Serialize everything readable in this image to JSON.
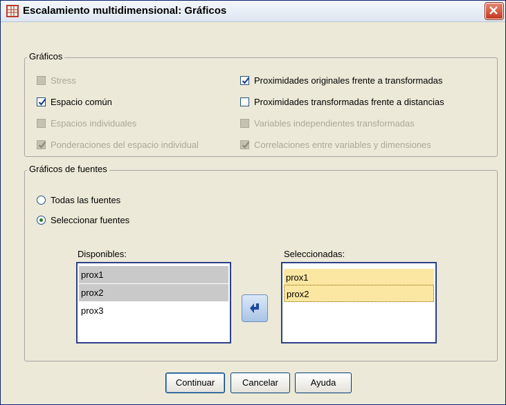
{
  "window": {
    "title": "Escalamiento multidimensional: Gráficos"
  },
  "graficos": {
    "label": "Gráficos",
    "options": [
      {
        "label": "Stress",
        "checked": false,
        "disabled": true
      },
      {
        "label": "Espacio común",
        "checked": true,
        "disabled": false
      },
      {
        "label": "Espacios individuales",
        "checked": false,
        "disabled": true
      },
      {
        "label": "Ponderaciones del espacio individual",
        "checked": true,
        "disabled": true
      },
      {
        "label": "Proximidades originales frente a transformadas",
        "checked": true,
        "disabled": false
      },
      {
        "label": "Proximidades transformadas frente a distancias",
        "checked": false,
        "disabled": false
      },
      {
        "label": "Variables independientes transformadas",
        "checked": false,
        "disabled": true
      },
      {
        "label": "Correlaciones entre variables y dimensiones",
        "checked": true,
        "disabled": true
      }
    ]
  },
  "fuentes": {
    "label": "Gráficos de fuentes",
    "radios": [
      {
        "label": "Todas las fuentes",
        "selected": false
      },
      {
        "label": "Seleccionar fuentes",
        "selected": true
      }
    ],
    "available_label": "Disponibles:",
    "available": [
      "prox1",
      "prox2",
      "prox3"
    ],
    "selected_label": "Seleccionadas:",
    "selected": [
      "prox1",
      "prox2"
    ]
  },
  "buttons": {
    "continue": "Continuar",
    "cancel": "Cancelar",
    "help": "Ayuda"
  },
  "colors": {
    "accent": "#1c5180",
    "selection_gray": "#c9c9c9",
    "selection_yellow": "#fbe7a1",
    "close": "#c2391e"
  }
}
